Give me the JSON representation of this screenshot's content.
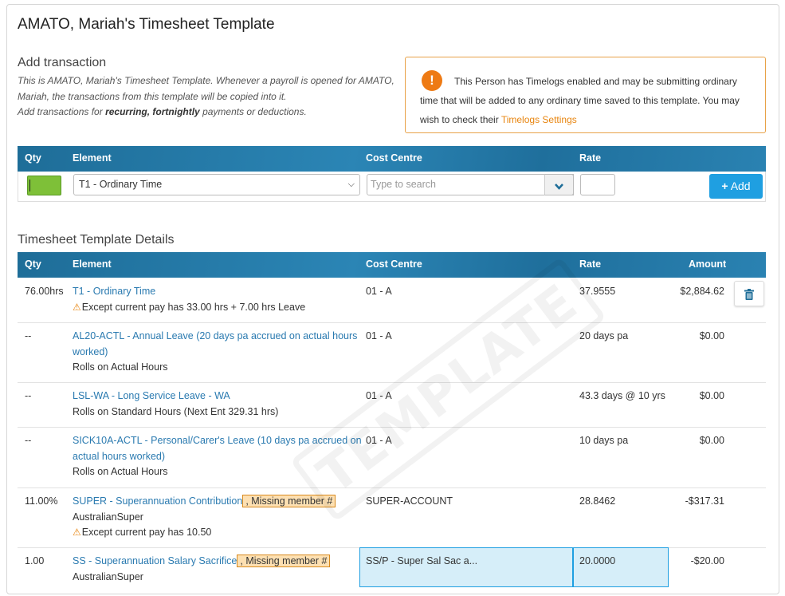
{
  "page_title": "AMATO, Mariah's Timesheet Template",
  "add_section": {
    "title": "Add transaction",
    "intro_line1": "This is AMATO, Mariah's Timesheet Template. Whenever a payroll is opened for AMATO, Mariah, the transactions from this template will be copied into it.",
    "intro_line2_pre": "Add transactions for ",
    "intro_line2_bold": "recurring, fortnightly",
    "intro_line2_post": " payments or deductions."
  },
  "notice": {
    "icon": "exclamation-icon",
    "text": "This Person has Timelogs enabled and may be submitting ordinary time that will be added to any ordinary time saved to this template. You may wish to check their ",
    "link": "Timelogs Settings",
    "accent": "#e8850f"
  },
  "add_table": {
    "headers": {
      "qty": "Qty",
      "element": "Element",
      "cost_centre": "Cost Centre",
      "rate": "Rate"
    },
    "element_value": "T1 - Ordinary Time",
    "cost_centre_placeholder": "Type to search",
    "add_label": "Add"
  },
  "details": {
    "title": "Timesheet Template Details",
    "headers": {
      "qty": "Qty",
      "element": "Element",
      "cost_centre": "Cost Centre",
      "rate": "Rate",
      "amount": "Amount"
    },
    "rows": [
      {
        "qty": "76.00hrs",
        "element": "T1 - Ordinary Time",
        "warn": "Except current pay has 33.00 hrs + 7.00 hrs Leave",
        "cost_centre": "01 - A",
        "rate": "37.9555",
        "amount": "$2,884.62"
      },
      {
        "qty": "--",
        "element": "AL20-ACTL - Annual Leave (20 days pa accrued on actual hours worked)",
        "sub": "Rolls on Actual Hours",
        "cost_centre": "01 - A",
        "rate": "20 days pa",
        "amount": "$0.00"
      },
      {
        "qty": "--",
        "element": "LSL-WA - Long Service Leave - WA",
        "sub": "Rolls on Standard Hours (Next Ent 329.31 hrs)",
        "cost_centre": "01 - A",
        "rate": "43.3 days @ 10 yrs",
        "amount": "$0.00"
      },
      {
        "qty": "--",
        "element": "SICK10A-ACTL - Personal/Carer's Leave (10 days pa accrued on actual hours worked)",
        "sub": "Rolls on Actual Hours",
        "cost_centre": "01 - A",
        "rate": "10 days pa",
        "amount": "$0.00"
      },
      {
        "qty": "11.00%",
        "element": "SUPER - Superannuation Contribution",
        "missing": ", Missing member #",
        "sub": "AustralianSuper",
        "warn": "Except current pay has 10.50",
        "cost_centre": "SUPER-ACCOUNT",
        "rate": "28.8462",
        "amount": "-$317.31"
      },
      {
        "qty": "1.00",
        "element": "SS - Superannuation Salary Sacrifice",
        "missing": ", Missing member #",
        "sub": "AustralianSuper",
        "cost_centre": "SS/P - Super Sal Sac a...",
        "rate": "20.0000",
        "amount": "-$20.00"
      }
    ]
  },
  "watermark": "TEMPLATE",
  "colors": {
    "header_blue": "#1e6d98",
    "link_blue": "#2a7ab0",
    "add_button": "#1f9fe1",
    "qty_green": "#7ec038"
  }
}
